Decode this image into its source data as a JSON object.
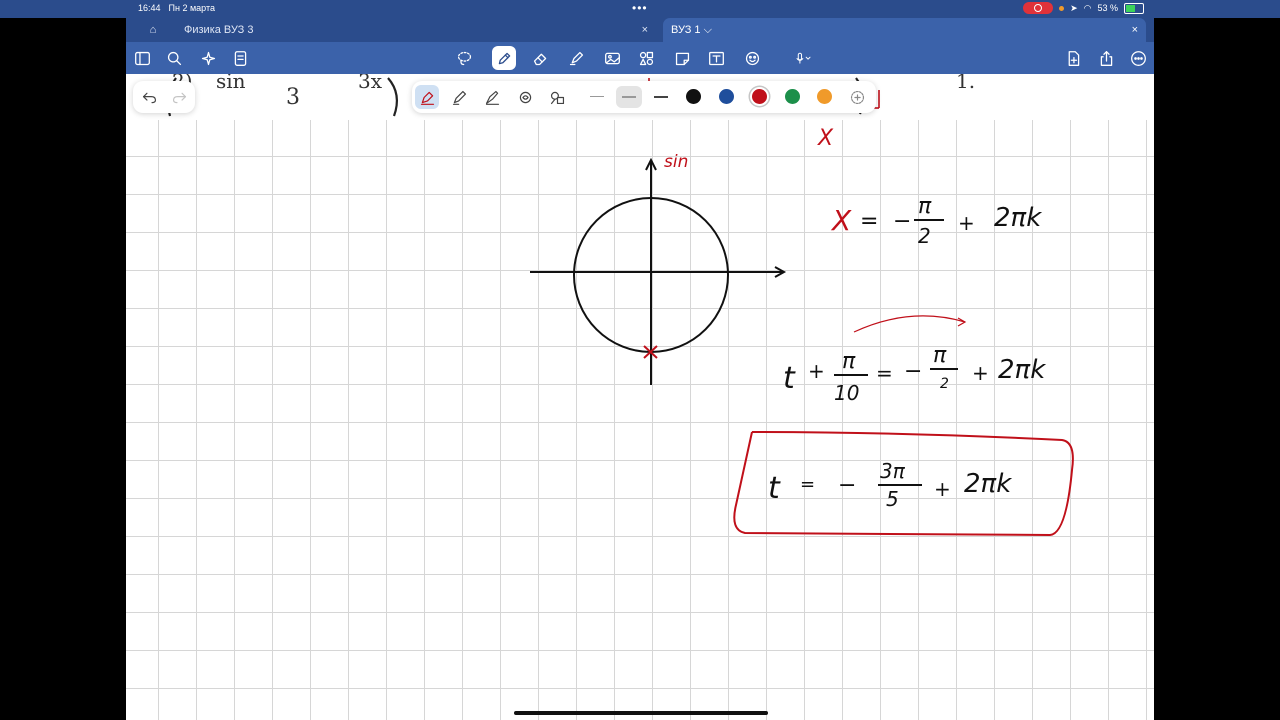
{
  "status": {
    "time": "16:44",
    "date": "Пн 2 марта",
    "battery": "53 %"
  },
  "tabs": [
    {
      "label": "Физика ВУЗ 3",
      "close": "×"
    },
    {
      "label": "ВУЗ 1 ⌵",
      "close": "×"
    }
  ],
  "ribbon": {
    "left_icons": [
      "sidebar-icon",
      "search-icon",
      "sparkle-icon",
      "notebook-icon"
    ],
    "center_icons": [
      "lasso-icon",
      "pen-icon",
      "eraser-icon",
      "highlighter-icon",
      "image-icon",
      "shapes-icon",
      "sticker-icon",
      "textbox-icon",
      "elements-icon",
      "microphone-icon"
    ],
    "right_icons": [
      "new-page-icon",
      "share-icon",
      "more-icon"
    ]
  },
  "pen_toolbar": {
    "colors": [
      "#111111",
      "#1f4e9c",
      "#c0101a",
      "#1c8f4a",
      "#f09a2a"
    ]
  },
  "handwriting": {
    "axis_label": "sin",
    "top_x": "X",
    "eq1": {
      "lhs": "X",
      "eq": "=",
      "minus": "−",
      "num": "π",
      "den": "2",
      "plus": "+",
      "tail": "2πk"
    },
    "eq2": {
      "var": "t",
      "plus1": "+",
      "num1": "π",
      "den1": "10",
      "eq": "=",
      "minus": "−",
      "num2": "π",
      "den2": "2",
      "plus2": "+",
      "tail": "2πk"
    },
    "eq3": {
      "var": "t",
      "eq": "=",
      "minus": "−",
      "num": "3π",
      "den": "5",
      "plus": "+",
      "tail": "2πk"
    }
  }
}
